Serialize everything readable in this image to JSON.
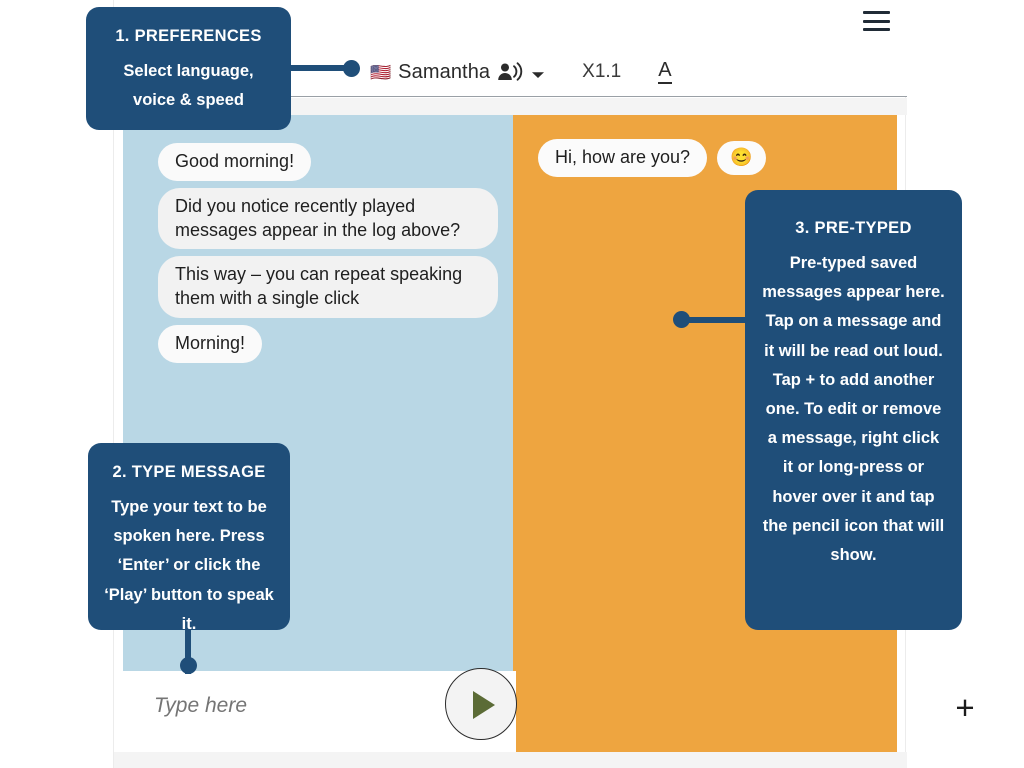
{
  "app": {
    "menu_icon": "hamburger-menu-icon"
  },
  "toolbar": {
    "flag": "🇺🇸",
    "voice_name": "Samantha",
    "voice_icon": "person-speaking-icon",
    "dropdown_icon": "chevron-down-icon",
    "speed": "X1.1",
    "font_icon_label": "A"
  },
  "left_panel": {
    "label": "recently-played-log",
    "messages": [
      "Good morning!",
      "Did you notice recently played messages appear in the log above?",
      "This way – you can repeat speaking them with a single click",
      "Morning!"
    ]
  },
  "right_panel": {
    "label": "pre-typed-messages",
    "messages": [
      "Hi, how are you?"
    ],
    "emoji": "😊",
    "add_button_label": "+"
  },
  "composer": {
    "placeholder": "Type here",
    "value": "",
    "play_button_label": "play-icon"
  },
  "callouts": [
    {
      "id": "1",
      "title": "1. PREFERENCES",
      "body": "Select language, voice & speed"
    },
    {
      "id": "2",
      "title": "2. TYPE MESSAGE",
      "body": "Type your text to be spoken here. Press ‘Enter’ or click the ‘Play’ button to speak it."
    },
    {
      "id": "3",
      "title": "3. PRE-TYPED",
      "body": "Pre-typed saved messages appear here. Tap on a message and it will be read out loud. Tap + to add another one. To edit or remove a message, right click it or long-press or hover over it and tap the pencil icon that will show."
    }
  ],
  "colors": {
    "callout_navy": "#1f4e79",
    "left_panel_blue": "#b9d7e5",
    "right_panel_orange": "#eea540",
    "play_green": "#5b6b36"
  }
}
